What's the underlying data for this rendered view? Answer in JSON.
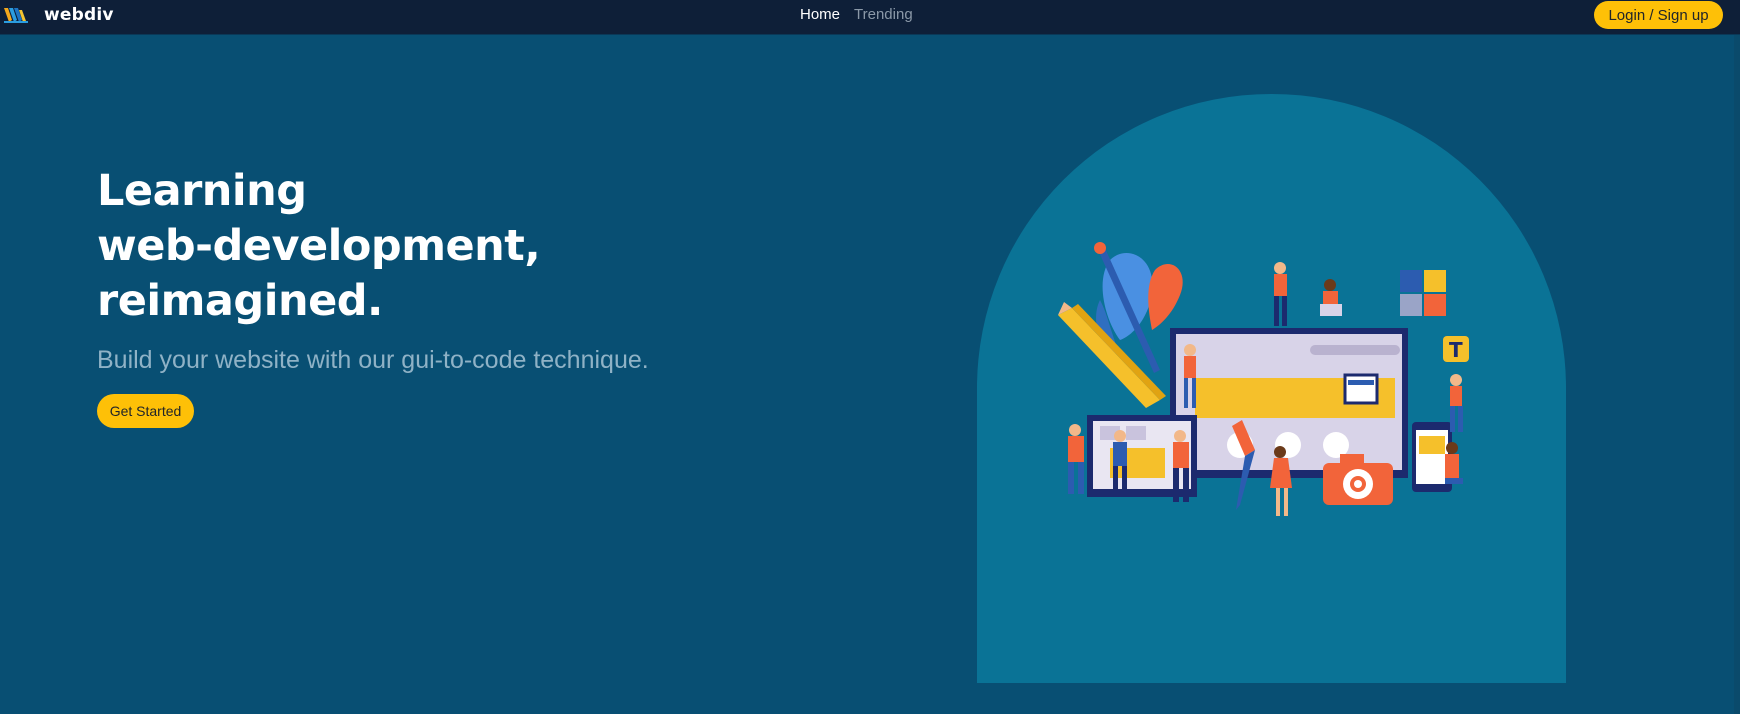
{
  "navbar": {
    "brand": "webdiv",
    "links": [
      {
        "label": "Home",
        "active": true
      },
      {
        "label": "Trending",
        "active": false
      }
    ],
    "login_label": "Login / Sign up"
  },
  "hero": {
    "title_lines": [
      "Learning",
      "web-development,",
      "reimagined."
    ],
    "subtitle": "Build your website with our gui-to-code technique.",
    "cta_label": "Get Started"
  },
  "colors": {
    "background": "#084f73",
    "navbar": "#0e1f38",
    "accent": "#fec007",
    "arch": "#0a7396"
  },
  "icons": {
    "logo": "webdiv-logo-icon",
    "illustration": "web-development-team-illustration"
  }
}
